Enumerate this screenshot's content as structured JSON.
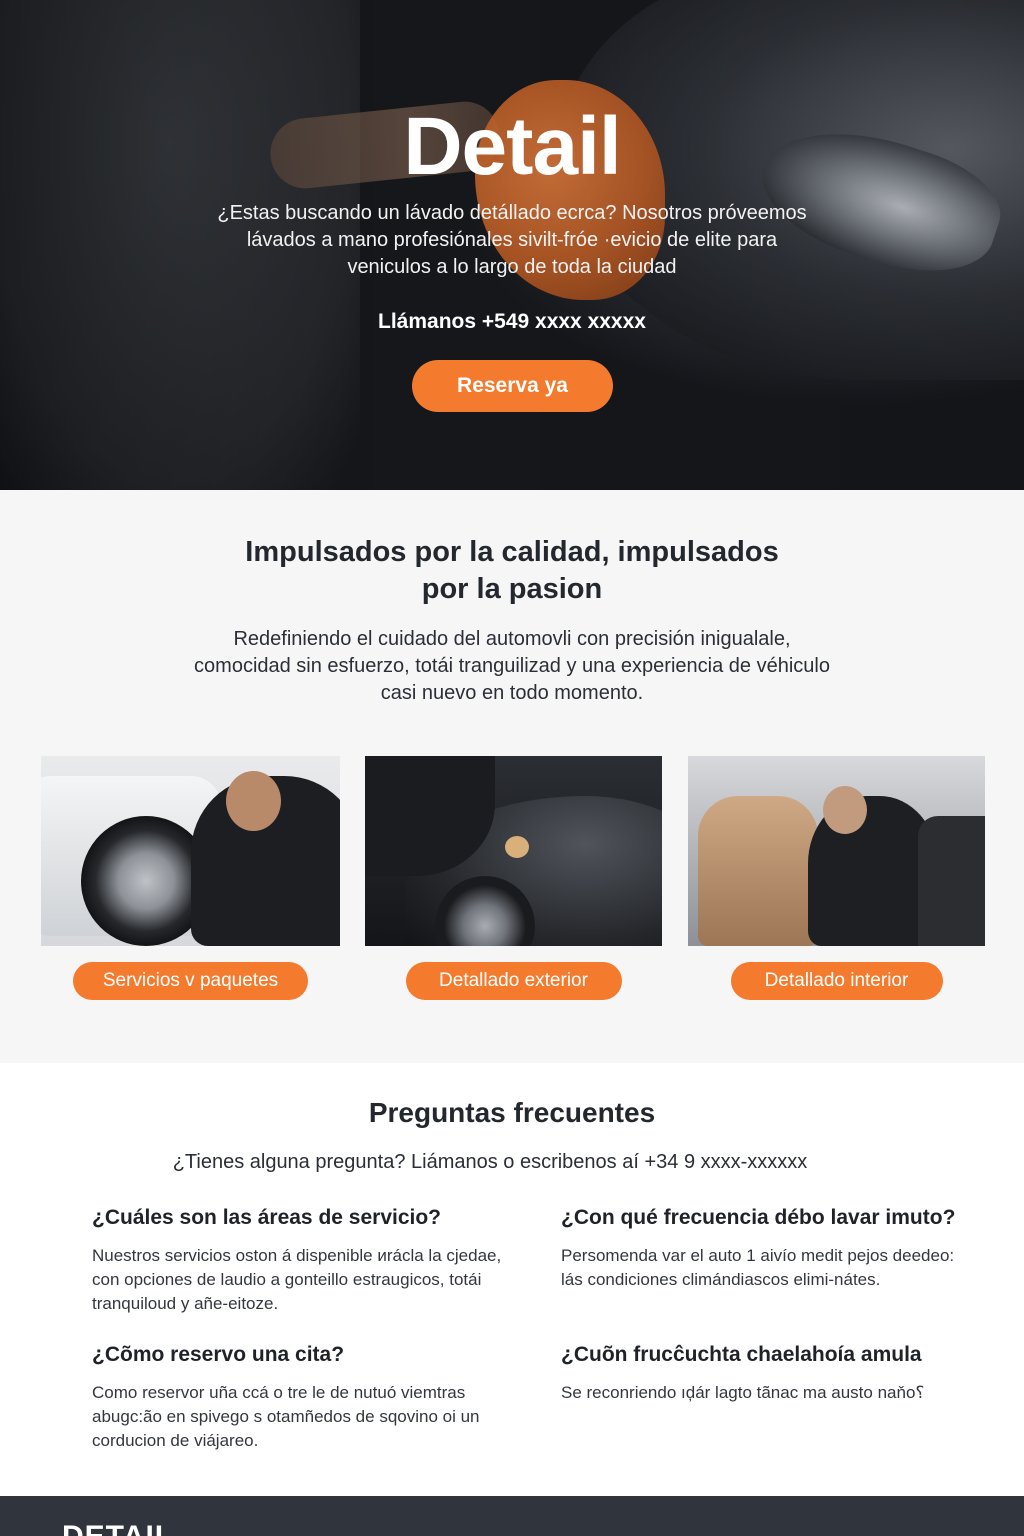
{
  "hero": {
    "title": "Detail",
    "description": "¿Estas buscando un lávado detállado ecrca? Nosotros próveemos lávados a mano profesiónales sivilt-fróe ·evicio de elite para veniculos a lo largo de toda la ciudad",
    "phone": "Llámanos +549 xxxx xxxxx",
    "cta_label": "Reserva ya"
  },
  "quality": {
    "title_line1": "Impulsados por la calidad, impulsados",
    "title_line2": "por la pasion",
    "text": "Redefiniendo el cuidado del automovli con precisión inigualale, comocidad sin esfuerzo, totái tranguilizad y una experiencia de véhiculo casi nuevo en todo momento.",
    "cards": [
      {
        "button": "Servicios v paquetes"
      },
      {
        "button": "Detallado exterior"
      },
      {
        "button": "Detallado interior"
      }
    ]
  },
  "faq": {
    "title": "Preguntas frecuentes",
    "subtitle": "¿Tienes alguna pregunta? Liámanos o escribenos aí +34 9 xxxx-xxxxxx",
    "items": [
      {
        "q": "¿Cuáles son las áreas de servicio?",
        "a": "Nuestros servicios oston á dispenible ᴎrácla la cjedae, con opciones de laudio a gonteillo estraugicos, totái tranquiloud y añe-eitoze."
      },
      {
        "q": "¿Con qué frecuencia débo lavar imuto?",
        "a": "Persomenda var el auto 1 aivío medit pejos deedeo: lás condiciones climándiascos elimi-nátes."
      },
      {
        "q": "¿Cõmo reservo una cita?",
        "a": "Como reservor uña ccá o tre le de nutuó viemtras abugc:ão en spivego s otamñedos de sqovino oi un corducion de viájareo."
      },
      {
        "q": "¿Cuõn frucĉuchta chaelahoía amula",
        "a": "Se reconriendo ıḑár lagto tãnac ma austo naňo⸮"
      }
    ]
  },
  "footer": {
    "logo": "DETAIL"
  },
  "colors": {
    "accent": "#f47a2e",
    "footer_bg": "#2f343d",
    "section_bg": "#f6f6f6"
  }
}
